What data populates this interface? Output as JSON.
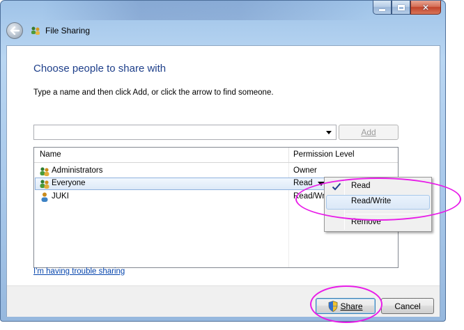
{
  "window": {
    "title": "File Sharing",
    "colors": {
      "accent": "#1e3f8a",
      "link": "#0645ad",
      "highlight": "#e81ce8"
    }
  },
  "content": {
    "heading": "Choose people to share with",
    "instruction": "Type a name and then click Add, or click the arrow to find someone.",
    "name_input": {
      "value": "",
      "placeholder": ""
    },
    "add_label": "Add"
  },
  "list": {
    "columns": {
      "name": "Name",
      "permission": "Permission Level"
    },
    "rows": [
      {
        "name": "Administrators",
        "permission": "Owner",
        "icon": "group-icon"
      },
      {
        "name": "Everyone",
        "permission": "Read",
        "icon": "group-icon",
        "selected": true
      },
      {
        "name": "JUKI",
        "permission": "Read/Write",
        "icon": "user-icon"
      }
    ]
  },
  "permission_menu": {
    "items": [
      {
        "label": "Read",
        "checked": true
      },
      {
        "label": "Read/Write",
        "hover": true
      },
      {
        "label": "Remove"
      }
    ]
  },
  "links": {
    "trouble": "I'm having trouble sharing"
  },
  "footer": {
    "share_label": "Share",
    "cancel_label": "Cancel"
  }
}
